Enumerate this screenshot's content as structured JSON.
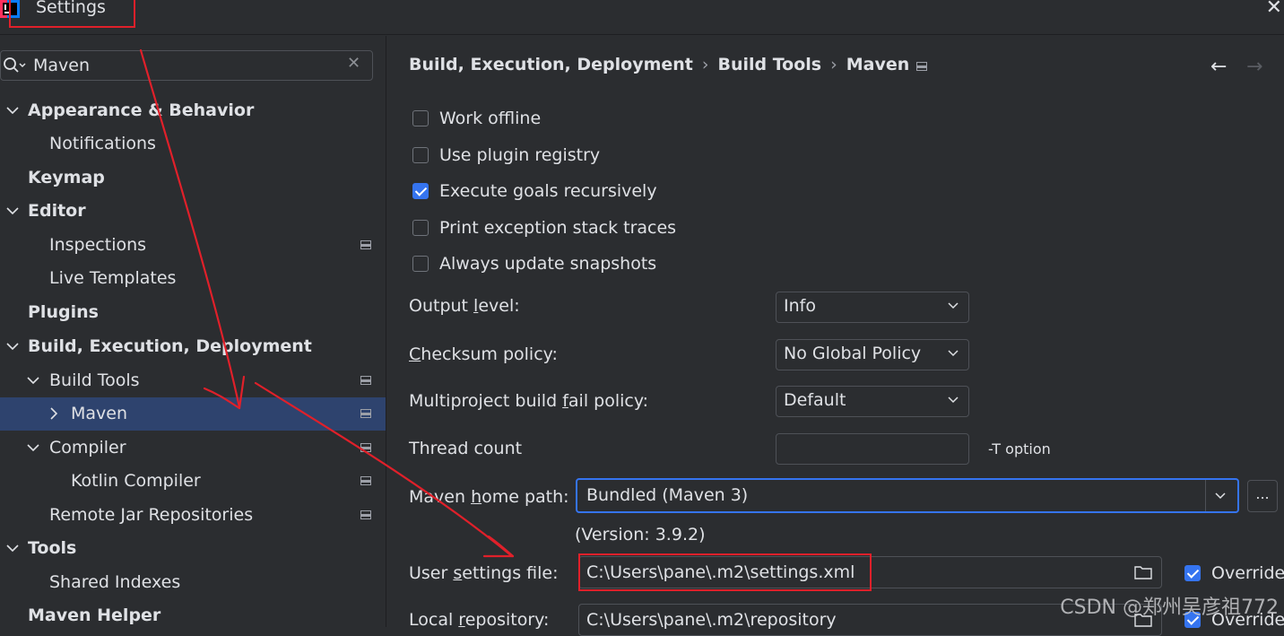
{
  "window": {
    "title": "Settings"
  },
  "search": {
    "value": "Maven"
  },
  "sidebar": {
    "items": [
      {
        "label": "Appearance & Behavior"
      },
      {
        "label": "Notifications"
      },
      {
        "label": "Keymap"
      },
      {
        "label": "Editor"
      },
      {
        "label": "Inspections"
      },
      {
        "label": "Live Templates"
      },
      {
        "label": "Plugins"
      },
      {
        "label": "Build, Execution, Deployment"
      },
      {
        "label": "Build Tools"
      },
      {
        "label": "Maven"
      },
      {
        "label": "Compiler"
      },
      {
        "label": "Kotlin Compiler"
      },
      {
        "label": "Remote Jar Repositories"
      },
      {
        "label": "Tools"
      },
      {
        "label": "Shared Indexes"
      },
      {
        "label": "Maven Helper"
      }
    ]
  },
  "breadcrumb": [
    "Build, Execution, Deployment",
    "Build Tools",
    "Maven"
  ],
  "options": {
    "work_offline": {
      "label": "Work offline",
      "checked": false
    },
    "use_plugin_registry": {
      "label": "Use plugin registry",
      "checked": false
    },
    "execute_goals_recursively": {
      "label": "Execute goals recursively",
      "checked": true
    },
    "print_exception_stack_traces": {
      "label": "Print exception stack traces",
      "checked": false
    },
    "always_update_snapshots": {
      "label": "Always update snapshots",
      "checked": false
    }
  },
  "fields": {
    "output_level": {
      "label_pre": "Output ",
      "label_mn": "l",
      "label_post": "evel:",
      "value": "Info"
    },
    "checksum_policy": {
      "label_pre": "",
      "label_mn": "C",
      "label_post": "hecksum policy:",
      "value": "No Global Policy"
    },
    "multiproject_fail_policy": {
      "label_pre": "Multiproject build ",
      "label_mn": "f",
      "label_post": "ail policy:",
      "value": "Default"
    },
    "thread_count": {
      "label": "Thread count",
      "value": "",
      "suffix": "-T option"
    },
    "maven_home_path": {
      "label_pre": "Maven ",
      "label_mn": "h",
      "label_post": "ome path:",
      "value": "Bundled (Maven 3)",
      "browse_label": "...",
      "version": "(Version: 3.9.2)"
    },
    "user_settings_file": {
      "label_pre": "User ",
      "label_mn": "s",
      "label_post": "ettings file:",
      "value": "C:\\Users\\pane\\.m2\\settings.xml",
      "override_label": "Override",
      "override_checked": true
    },
    "local_repository": {
      "label_pre": "Local ",
      "label_mn": "r",
      "label_post": "epository:",
      "value": "C:\\Users\\pane\\.m2\\repository",
      "override_label": "Override",
      "override_checked": true
    }
  },
  "watermark": "CSDN @郑州吴彦祖772",
  "colors": {
    "background": "#2b2d30",
    "selection": "#2e436e",
    "accent": "#3574f0",
    "annotation_red": "#e0202a"
  }
}
